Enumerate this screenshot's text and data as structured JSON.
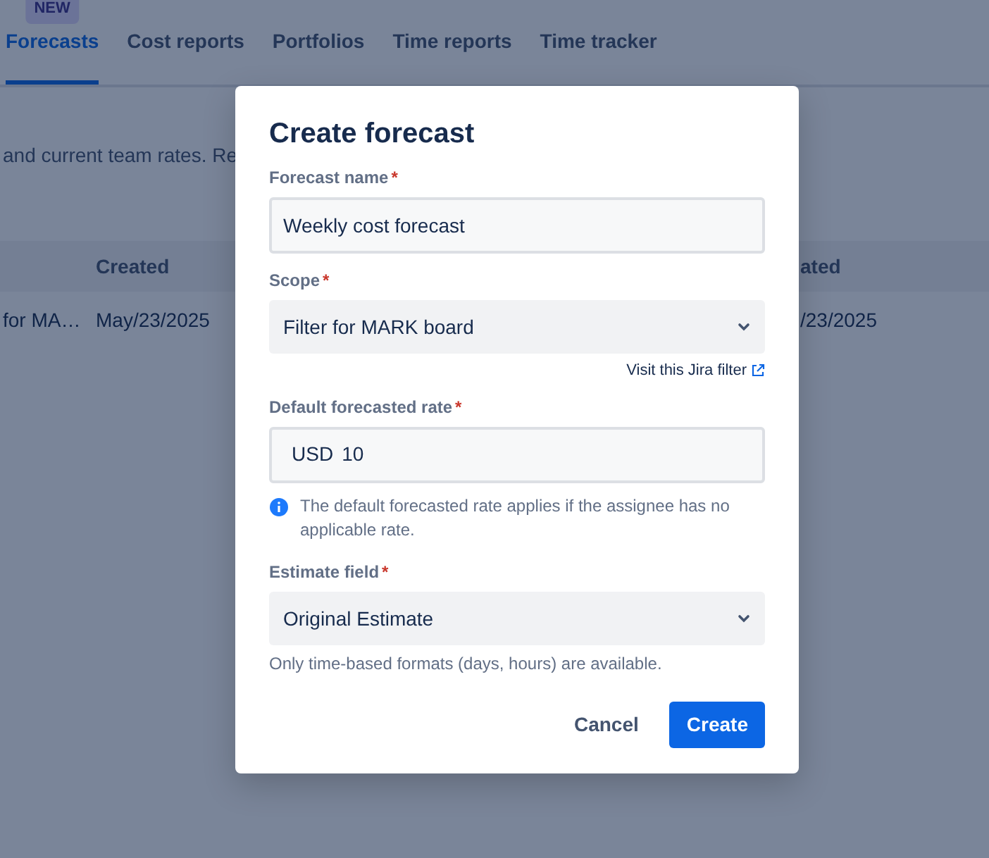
{
  "tabs": [
    {
      "label": "Forecasts",
      "selected": true,
      "badge": "NEW"
    },
    {
      "label": "Cost reports",
      "selected": false
    },
    {
      "label": "Portfolios",
      "selected": false
    },
    {
      "label": "Time reports",
      "selected": false
    },
    {
      "label": "Time tracker",
      "selected": false
    }
  ],
  "intro": {
    "text": "and current team rates.",
    "link": "Re"
  },
  "table": {
    "columns": [
      "",
      "Created",
      "ated"
    ],
    "rows": [
      {
        "cells": [
          "for MA…",
          "May/23/2025",
          "/23/2025"
        ]
      }
    ]
  },
  "dialog": {
    "title": "Create forecast",
    "fields": [
      {
        "kind": "text",
        "label": "Forecast name",
        "required_mark": "*",
        "value": "Weekly cost forecast"
      },
      {
        "kind": "select",
        "label": "Scope",
        "required_mark": "*",
        "value": "Filter for MARK board",
        "link": "Visit this Jira filter"
      },
      {
        "kind": "currency",
        "label": "Default forecasted rate",
        "required_mark": "*",
        "prefix": "USD",
        "value": "10",
        "info": "The default forecasted rate applies if the assignee has no applicable rate."
      },
      {
        "kind": "select",
        "label": "Estimate field",
        "required_mark": "*",
        "value": "Original Estimate",
        "help": "Only time-based formats (days, hours) are available."
      }
    ],
    "buttons": [
      {
        "label": "Cancel",
        "kind": "subtle"
      },
      {
        "label": "Create",
        "kind": "primary"
      }
    ]
  }
}
